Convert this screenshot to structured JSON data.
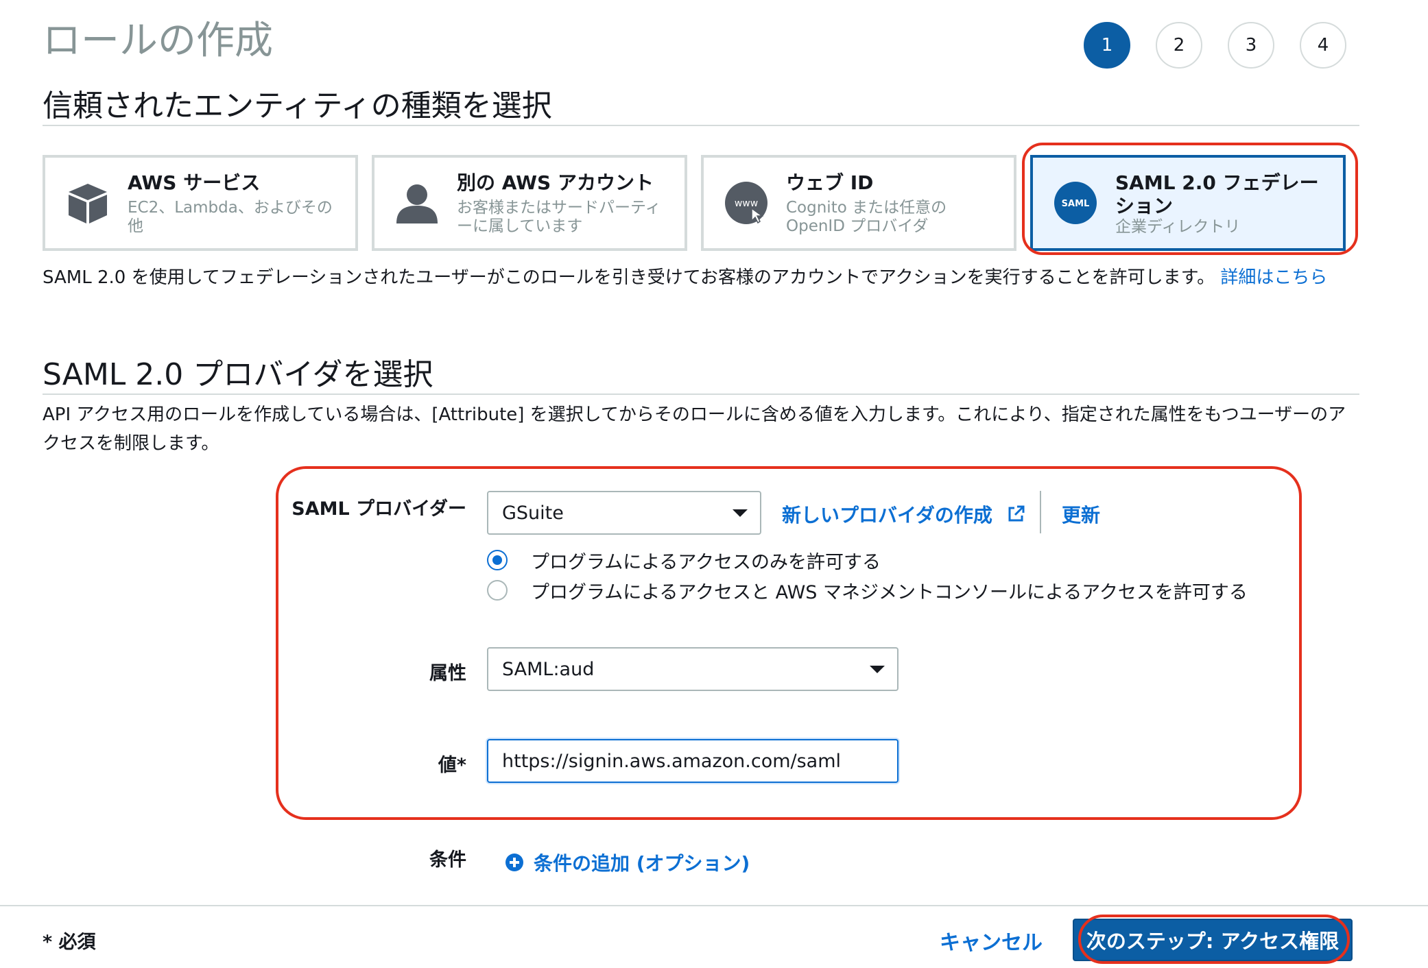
{
  "header": {
    "page_title": "ロールの作成",
    "steps": [
      "1",
      "2",
      "3",
      "4"
    ],
    "active_step": 1
  },
  "entity_section": {
    "title": "信頼されたエンティティの種類を選択",
    "cards": [
      {
        "title": "AWS サービス",
        "desc": "EC2、Lambda、およびその他",
        "icon": "cube-icon"
      },
      {
        "title": "別の AWS アカウント",
        "desc": "お客様またはサードパーティーに属しています",
        "icon": "user-icon"
      },
      {
        "title": "ウェブ ID",
        "desc": "Cognito または任意の OpenID プロバイダ",
        "icon": "www-icon",
        "icon_text": "www"
      },
      {
        "title": "SAML 2.0 フェデレーション",
        "desc": "企業ディレクトリ",
        "icon": "saml-icon",
        "icon_text": "SAML",
        "selected": true
      }
    ],
    "description": "SAML 2.0 を使用してフェデレーションされたユーザーがこのロールを引き受けてお客様のアカウントでアクションを実行することを許可します。",
    "more_link": "詳細はこちら"
  },
  "saml_section": {
    "title": "SAML 2.0 プロバイダを選択",
    "description": "API アクセス用のロールを作成している場合は、[Attribute] を選択してからそのロールに含める値を入力します。これにより、指定された属性をもつユーザーのアクセスを制限します。"
  },
  "form": {
    "provider_label": "SAML プロバイダー",
    "provider_value": "GSuite",
    "create_provider_link": "新しいプロバイダの作成",
    "refresh_link": "更新",
    "access_options": [
      {
        "label": "プログラムによるアクセスのみを許可する",
        "selected": true
      },
      {
        "label": "プログラムによるアクセスと AWS マネジメントコンソールによるアクセスを許可する",
        "selected": false
      }
    ],
    "attribute_label": "属性",
    "attribute_value": "SAML:aud",
    "value_label": "値*",
    "value_input": "https://signin.aws.amazon.com/saml",
    "condition_label": "条件",
    "add_condition_link": "条件の追加 (オプション)"
  },
  "footer": {
    "required_note": "* 必須",
    "cancel_label": "キャンセル",
    "next_label": "次のステップ: アクセス権限"
  },
  "colors": {
    "primary": "#0c5ea4",
    "link": "#0c6fd3",
    "annotation_red": "#e5301d",
    "muted": "#879596"
  }
}
